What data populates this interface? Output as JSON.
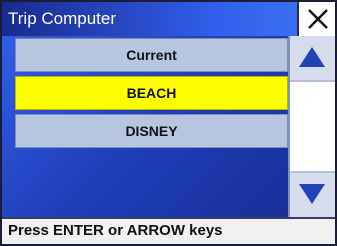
{
  "window": {
    "title": "Trip Computer",
    "close_icon": "close-icon"
  },
  "list": {
    "items": [
      {
        "label": "Current",
        "selected": false
      },
      {
        "label": "BEACH",
        "selected": true
      },
      {
        "label": "DISNEY",
        "selected": false
      }
    ]
  },
  "scrollbar": {
    "up_icon": "triangle-up-icon",
    "down_icon": "triangle-down-icon"
  },
  "status": {
    "hint": "Press ENTER or ARROW keys"
  },
  "colors": {
    "selection": "#ffff00",
    "item_background": "#b7c5df",
    "title_gradient_start": "#1a2a8c",
    "title_gradient_end": "#3a6ff2",
    "arrow": "#1f45b8"
  }
}
